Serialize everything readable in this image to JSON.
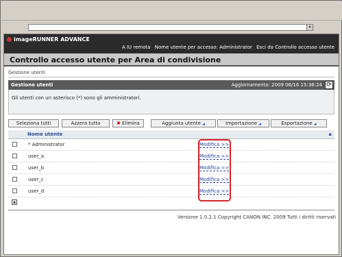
{
  "browser": {
    "address_value": "",
    "dropdown_glyph": "▾"
  },
  "brand": {
    "name": "imageRUNNER ADVANCE"
  },
  "top_links": {
    "remote_ui": "A IU remota",
    "user_label": "Nome utente per accesso: Administrator",
    "logout": "Esci da Controllo accesso utente"
  },
  "page": {
    "title": "Controllo accesso utente per Area di condivisione",
    "breadcrumb": "Gestione utenti"
  },
  "panel": {
    "title": "Gestione utenti",
    "updated": "Aggiornamento: 2009 06/16 15:36:24",
    "message": "Gli utenti con un asterisco (*) sono gli amministratori.",
    "refresh_glyph": "⟳"
  },
  "toolbar": {
    "select_all": "Seleziona tutti",
    "clear_all": "Azzera tutto",
    "delete": "Elimina",
    "delete_glyph": "✖",
    "add_user": "Aggiunta utente",
    "import": "Importazione",
    "export": "Esportazione",
    "arrow": "◢"
  },
  "table": {
    "header": "Nome utente",
    "sort_glyph": "▲",
    "rows": [
      {
        "name": "* Administrator",
        "action": "Modifica >>"
      },
      {
        "name": "user_a",
        "action": "Modifica >>"
      },
      {
        "name": "user_b",
        "action": "Modifica >>"
      },
      {
        "name": "user_c",
        "action": "Modifica >>"
      },
      {
        "name": "user_d",
        "action": "Modifica >>"
      }
    ]
  },
  "back_to_top_glyph": "▲",
  "footer": "Versione 1.0.2.1 Copyright CANON INC. 2009 Tutti i diritti riservati",
  "colors": {
    "highlight": "#d4232b",
    "link": "#1c3f9a",
    "topbar": "#2b2b2b"
  }
}
